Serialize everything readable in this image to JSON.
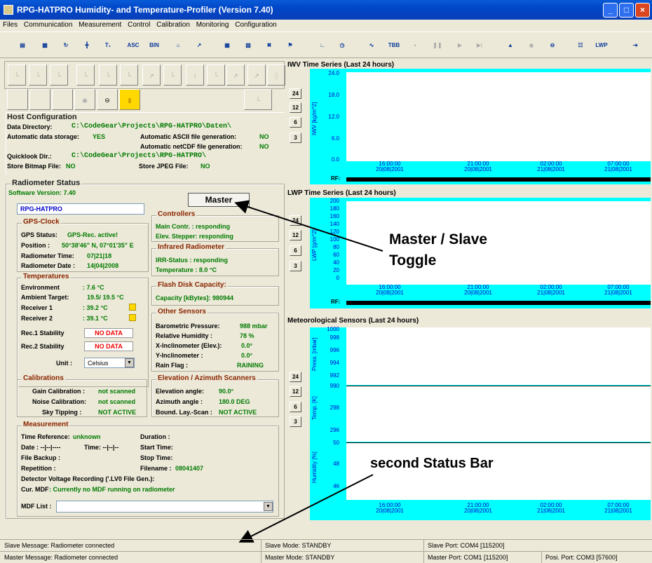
{
  "window": {
    "title": "RPG-HATPRO Humidity- and Temperature-Profiler (Version 7.40)"
  },
  "menu": [
    "Files",
    "Communication",
    "Measurement",
    "Control",
    "Calibration",
    "Monitoring",
    "Configuration"
  ],
  "host": {
    "title": "Host Configuration",
    "data_dir_label": "Data Directory:",
    "data_dir": "C:\\CodeGear\\Projects\\RPG-HATPRO\\Daten\\",
    "auto_storage_label": "Automatic data storage:",
    "auto_storage": "YES",
    "ascii_label": "Automatic ASCII file generation:",
    "ascii": "NO",
    "netcdf_label": "Automatic netCDF file generation:",
    "netcdf": "NO",
    "ql_label": "Quicklook Dir.:",
    "ql": "C:\\CodeGear\\Projects\\RPG-HATPRO\\",
    "bmp_label": "Store Bitmap File:",
    "bmp": "NO",
    "jpeg_label": "Store JPEG File:",
    "jpeg": "NO"
  },
  "radiometer": {
    "title": "Radiometer Status",
    "sw_version": "Software Version: 7.40",
    "name": "RPG-HATPRO",
    "master_button": "Master"
  },
  "gps": {
    "title": "GPS-Clock",
    "status_label": "GPS Status:",
    "status": "GPS-Rec. active!",
    "pos_label": "Position :",
    "pos": "50°38'46\" N, 07°01'35\" E",
    "time_label": "Radiometer Time:",
    "time": "07|21|18",
    "date_label": "Radiometer Date :",
    "date": "14|04|2008"
  },
  "temps": {
    "title": "Temperatures",
    "env_label": "Environment",
    "env": ": 7.6 °C",
    "amb_label": "Ambient Target:",
    "amb": "19.5/ 19.5 °C",
    "r1_label": "Receiver 1",
    "r1": ": 39.2 °C",
    "r2_label": "Receiver 2",
    "r2": ": 39.1 °C",
    "s1_label": "Rec.1 Stability",
    "s1": "NO DATA",
    "s2_label": "Rec.2 Stability",
    "s2": "NO DATA",
    "unit_label": "Unit :",
    "unit": "Celsius"
  },
  "controllers": {
    "title": "Controllers",
    "main": "Main Contr. : responding",
    "stepper": "Elev. Stepper: responding"
  },
  "irr": {
    "title": "Infrared Radiometer",
    "status": "IRR-Status : responding",
    "temp": "Temperature : 8.0 °C"
  },
  "flash": {
    "title": "Flash Disk Capacity:",
    "cap": "Capacity [kBytes]: 980944"
  },
  "sensors": {
    "title": "Other Sensors",
    "press_label": "Barometric Pressure:",
    "press": "988 mbar",
    "hum_label": "Relative Humidity :",
    "hum": "78 %",
    "xinc_label": "X-Inclinometer (Elev.):",
    "xinc": "0.0°",
    "yinc_label": "Y-Inclinometer :",
    "yinc": "0.0°",
    "rain_label": "Rain Flag :",
    "rain": "RAINING"
  },
  "calib": {
    "title": "Calibrations",
    "gain_label": "Gain Calibration :",
    "gain": "not scanned",
    "noise_label": "Noise Calibration:",
    "noise": "not scanned",
    "sky_label": "Sky Tipping :",
    "sky": "NOT ACTIVE"
  },
  "scanners": {
    "title": "Elevation / Azimuth Scanners",
    "elev_label": "Elevation angle:",
    "elev": "90.0°",
    "az_label": "Azimuth angle :",
    "az": "180.0 DEG",
    "bl_label": "Bound. Lay.-Scan :",
    "bl": "NOT ACTIVE"
  },
  "meas": {
    "title": "Measurement",
    "tref_label": "Time Reference:",
    "tref": "unknown",
    "dur_label": "Duration :",
    "date_label": "Date : --|--|----",
    "time_label": "Time: --|--|--",
    "start_label": "Start Time:",
    "backup_label": "File Backup :",
    "stop_label": "Stop Time:",
    "rep_label": "Repetition :",
    "fname_label": "Filename :",
    "fname": "08041407",
    "det_label": "Detector Voltage Recording ('.LV0 File Gen.):",
    "mdf_label": "Cur. MDF",
    "mdf": ": Currently no MDF running on radiometer",
    "mdflist_label": "MDF List :"
  },
  "charts": {
    "iwv": {
      "title": "IWV Time Series (Last 24 hours)",
      "ylabel": "IWV [kg/m^2]",
      "yticks": [
        "24.0",
        "18.0",
        "12.0",
        "6.0",
        "0.0"
      ]
    },
    "lwp": {
      "title": "LWP Time Series (Last 24 hours)",
      "ylabel": "LWP [g/m^2]",
      "yticks": [
        "200",
        "180",
        "160",
        "140",
        "120",
        "100",
        "80",
        "60",
        "40",
        "20",
        "0"
      ]
    },
    "met": {
      "title": "Meteorological Sensors (Last 24 hours)",
      "plabel": "Press. [mbar]",
      "pticks": [
        "1000",
        "998",
        "996",
        "994",
        "992",
        "990"
      ],
      "tlabel": "Temp. [K]",
      "tticks": [
        "298",
        "296"
      ],
      "hlabel": "Humidity [%]",
      "hticks": [
        "50",
        "48",
        "46"
      ]
    },
    "ranges": [
      "24",
      "12",
      "6",
      "3"
    ],
    "rf": "RF:",
    "xticks": [
      {
        "t": "16:00:00",
        "d": "20|08|2001"
      },
      {
        "t": "21:00:00",
        "d": "20|08|2001"
      },
      {
        "t": "02:00:00",
        "d": "21|08|2001"
      },
      {
        "t": "07:00:00",
        "d": "21|08|2001"
      }
    ]
  },
  "annotations": {
    "toggle": "Master / Slave Toggle",
    "toggle1": "Master / Slave",
    "toggle2": "Toggle",
    "status": "second Status Bar"
  },
  "status": {
    "slave_msg": "Slave Message: Radiometer connected",
    "slave_mode": "Slave Mode: STANDBY",
    "slave_port": "Slave Port: COM4 [115200]",
    "master_msg": "Master Message: Radiometer connected",
    "master_mode": "Master Mode: STANDBY",
    "master_port": "Master Port: COM1 [115200]",
    "posi_port": "Posi. Port: COM3 [57600]"
  }
}
